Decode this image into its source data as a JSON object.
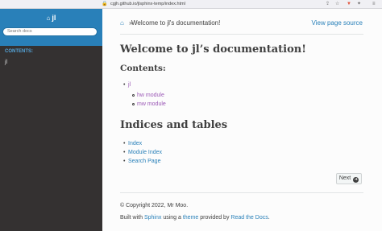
{
  "browser": {
    "url": "cgjh.github.io/jlsphinx-temp/index.html",
    "lock_icon": "lock-icon",
    "toolbar_icons": [
      "share-icon",
      "star-icon",
      "brave-shield-icon",
      "extensions-icon",
      "menu-icon"
    ]
  },
  "sidebar": {
    "project_name": "jl",
    "home_icon": "home-icon",
    "search_placeholder": "Search docs",
    "caption": "CONTENTS:",
    "toc": [
      {
        "label": "jl"
      }
    ]
  },
  "breadcrumb": {
    "home_icon": "home-icon",
    "separator": "»",
    "current": "Welcome to jl's documentation!",
    "view_source": "View page source"
  },
  "main": {
    "title": "Welcome to jl’s documentation!",
    "contents_heading": "Contents:",
    "toc": {
      "label": "jl",
      "children": [
        "hw module",
        "mw module"
      ]
    },
    "indices_heading": "Indices and tables",
    "indices": [
      "Index",
      "Module Index",
      "Search Page"
    ]
  },
  "footer": {
    "next_label": "Next",
    "copyright": "© Copyright 2022, Mr Moo.",
    "built_prefix": "Built with ",
    "sphinx": "Sphinx",
    "using_a": " using a ",
    "theme": "theme",
    "provided_by": " provided by ",
    "rtd": "Read the Docs",
    "period": "."
  },
  "colors": {
    "sidebar_bg": "#343131",
    "header_blue": "#2980b9",
    "link": "#2980b9",
    "visited_link": "#9b59b6",
    "text": "#404040"
  }
}
